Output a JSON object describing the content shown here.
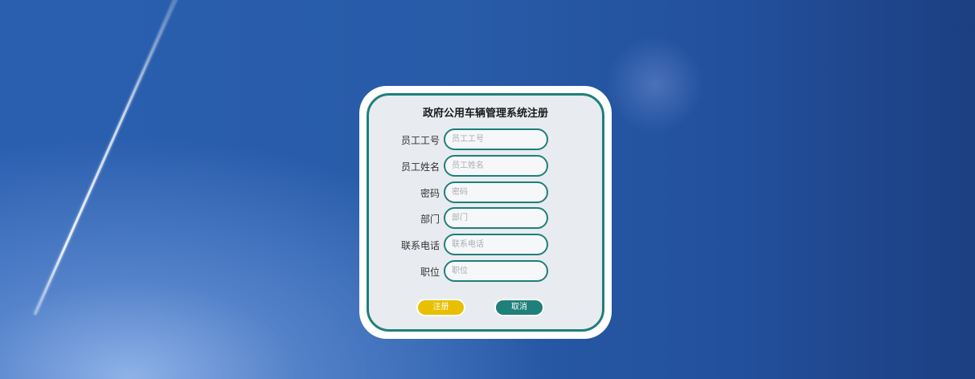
{
  "form": {
    "title": "政府公用车辆管理系统注册",
    "fields": [
      {
        "label": "员工工号",
        "placeholder": "员工工号",
        "value": ""
      },
      {
        "label": "员工姓名",
        "placeholder": "员工姓名",
        "value": ""
      },
      {
        "label": "密码",
        "placeholder": "密码",
        "value": ""
      },
      {
        "label": "部门",
        "placeholder": "部门",
        "value": ""
      },
      {
        "label": "联系电话",
        "placeholder": "联系电话",
        "value": ""
      },
      {
        "label": "职位",
        "placeholder": "职位",
        "value": ""
      }
    ],
    "register_label": "注册",
    "cancel_label": "取消"
  },
  "colors": {
    "accent": "#1f7f7a",
    "register": "#e8c000",
    "card": "#e8ebef"
  }
}
